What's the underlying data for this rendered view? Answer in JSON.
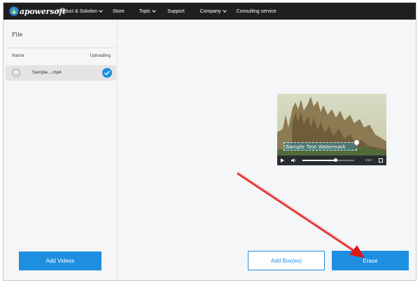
{
  "brand": {
    "logo_text": "apowersoft"
  },
  "nav": [
    {
      "label": "Product & Solution",
      "dropdown": true
    },
    {
      "label": "Store",
      "dropdown": false
    },
    {
      "label": "Topic",
      "dropdown": true
    },
    {
      "label": "Support",
      "dropdown": false
    },
    {
      "label": "Company",
      "dropdown": true
    },
    {
      "label": "Consulting service",
      "dropdown": false
    }
  ],
  "sidebar": {
    "title": "File",
    "col_name": "Name",
    "col_status": "Uploading",
    "files": [
      {
        "name": "Sample....mp4",
        "status": "uploaded"
      }
    ],
    "add_videos_label": "Add Videos"
  },
  "video": {
    "watermark_text": "Sample Text Watermark",
    "time": "0:24",
    "progress": 0.63
  },
  "actions": {
    "add_box_label": "Add Box(es)",
    "erase_label": "Erase"
  },
  "colors": {
    "accent": "#1e8fe0",
    "topbar": "#1f1f1f",
    "annotation_arrow": "#e01818"
  }
}
